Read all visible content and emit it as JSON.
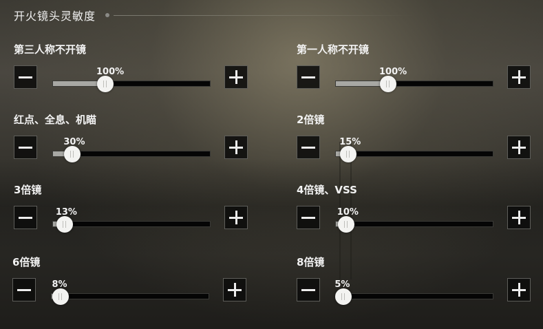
{
  "header": {
    "title": "开火镜头灵敏度"
  },
  "settings": [
    {
      "label": "第三人称不开镜",
      "value_text": "100%",
      "fraction": 1.0
    },
    {
      "label": "第一人称不开镜",
      "value_text": "100%",
      "fraction": 1.0
    },
    {
      "label": "红点、全息、机瞄",
      "value_text": "30%",
      "fraction": 0.3
    },
    {
      "label": "2倍镜",
      "value_text": "15%",
      "fraction": 0.15
    },
    {
      "label": "3倍镜",
      "value_text": "13%",
      "fraction": 0.13
    },
    {
      "label": "4倍镜、VSS",
      "value_text": "10%",
      "fraction": 0.1
    },
    {
      "label": "6倍镜",
      "value_text": "8%",
      "fraction": 0.08
    },
    {
      "label": "8倍镜",
      "value_text": "5%",
      "fraction": 0.05
    }
  ],
  "icons": {
    "decrease": "minus-icon",
    "increase": "plus-icon"
  },
  "colors": {
    "track": "#050505",
    "fill": "#a8a8a4",
    "thumb": "#f3f3f1",
    "button_bg": "#0c0c0b",
    "text": "#f2f2f2"
  }
}
